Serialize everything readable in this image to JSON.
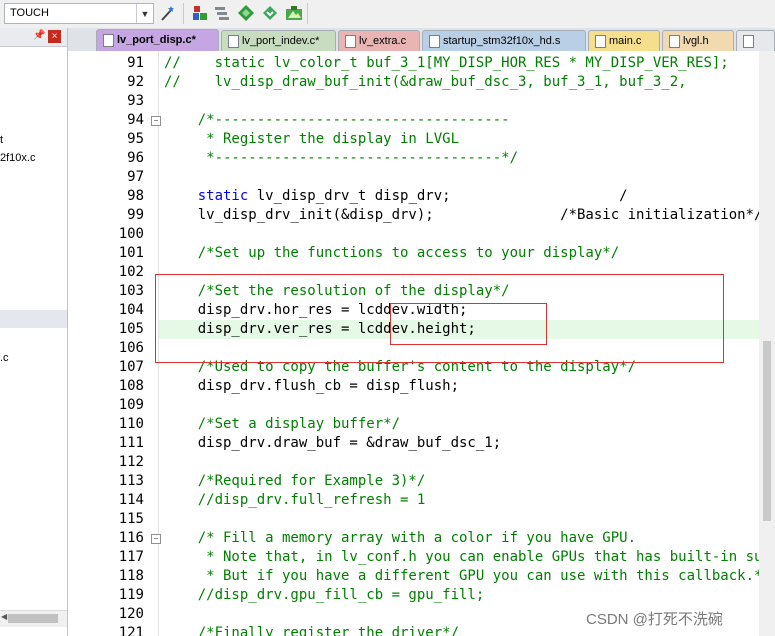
{
  "toolbar": {
    "target_value": "TOUCH",
    "icons": [
      "dropdown-chevron",
      "wand-icon",
      "options-icon",
      "manage-components-icon",
      "pack-installer-icon",
      "install-icon",
      "select-device-icon"
    ]
  },
  "project_panel": {
    "pin_icon": "pin-icon",
    "close_icon": "close-icon",
    "item_t": "t",
    "item_f10x": "2f10x.c",
    "item_c": ".c"
  },
  "tabs": [
    {
      "label": "lv_port_disp.c*",
      "active": true,
      "color": "#c5a6e3"
    },
    {
      "label": "lv_port_indev.c*",
      "active": false,
      "color": "#c8dcc0"
    },
    {
      "label": "lv_extra.c",
      "active": false,
      "color": "#e8b4b4"
    },
    {
      "label": "startup_stm32f10x_hd.s",
      "active": false,
      "color": "#b9cfe6"
    },
    {
      "label": "main.c",
      "active": false,
      "color": "#f6df8c"
    },
    {
      "label": "lvgl.h",
      "active": false,
      "color": "#f1dab0"
    }
  ],
  "editor": {
    "lines": [
      {
        "num": "91",
        "text": "//    static lv_color_t buf_3_1[MY_DISP_HOR_RES * MY_DISP_VER_RES];"
      },
      {
        "num": "92",
        "text": "//    lv_disp_draw_buf_init(&draw_buf_dsc_3, buf_3_1, buf_3_2,"
      },
      {
        "num": "93",
        "text": ""
      },
      {
        "num": "94",
        "text": "    /*-----------------------------------"
      },
      {
        "num": "95",
        "text": "     * Register the display in LVGL"
      },
      {
        "num": "96",
        "text": "     *----------------------------------*/"
      },
      {
        "num": "97",
        "text": ""
      },
      {
        "num": "98",
        "kw": "static",
        "text": " lv_disp_drv_t disp_drv;                    /"
      },
      {
        "num": "99",
        "text": "    lv_disp_drv_init(&disp_drv);               /*Basic initialization*/"
      },
      {
        "num": "100",
        "text": ""
      },
      {
        "num": "101",
        "text": "    /*Set up the functions to access to your display*/"
      },
      {
        "num": "102",
        "text": ""
      },
      {
        "num": "103",
        "text": "    /*Set the resolution of the display*/"
      },
      {
        "num": "104",
        "text": "    disp_drv.hor_res = lcddev.width;"
      },
      {
        "num": "105",
        "text": "    disp_drv.ver_res = lcddev.height;"
      },
      {
        "num": "106",
        "text": ""
      },
      {
        "num": "107",
        "text": "    /*Used to copy the buffer's content to the display*/"
      },
      {
        "num": "108",
        "text": "    disp_drv.flush_cb = disp_flush;"
      },
      {
        "num": "109",
        "text": ""
      },
      {
        "num": "110",
        "text": "    /*Set a display buffer*/"
      },
      {
        "num": "111",
        "text": "    disp_drv.draw_buf = &draw_buf_dsc_1;"
      },
      {
        "num": "112",
        "text": ""
      },
      {
        "num": "113",
        "text": "    /*Required for Example 3)*/"
      },
      {
        "num": "114",
        "text": "    //disp_drv.full_refresh = 1"
      },
      {
        "num": "115",
        "text": ""
      },
      {
        "num": "116",
        "text": "    /* Fill a memory array with a color if you have GPU."
      },
      {
        "num": "117",
        "text": "     * Note that, in lv_conf.h you can enable GPUs that has built-in support in LVGL."
      },
      {
        "num": "118",
        "text": "     * But if you have a different GPU you can use with this callback.*/"
      },
      {
        "num": "119",
        "text": "    //disp_drv.gpu_fill_cb = gpu_fill;"
      },
      {
        "num": "120",
        "text": ""
      },
      {
        "num": "121",
        "text": "    /*Finally register the driver*/"
      }
    ],
    "fold_markers": [
      "94",
      "116"
    ]
  },
  "watermark": "CSDN @打死不洗碗"
}
